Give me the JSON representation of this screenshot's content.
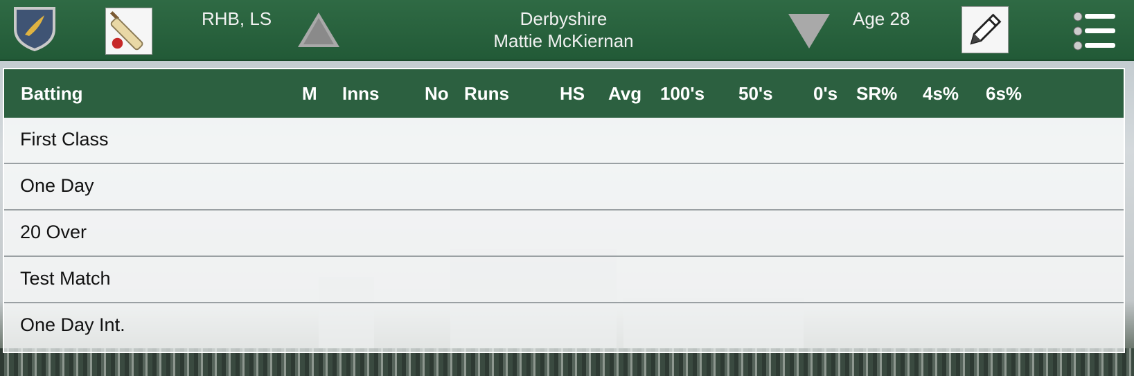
{
  "header": {
    "hand": "RHB, LS",
    "team": "Derbyshire",
    "player": "Mattie McKiernan",
    "age": "Age 28"
  },
  "icons": {
    "club": "shield-icon",
    "category": "cricket-bat-icon",
    "previous": "arrow-up-icon",
    "next": "arrow-down-icon",
    "edit": "pencil-icon",
    "menu": "menu-icon"
  },
  "table": {
    "columns": [
      "Batting",
      "M",
      "Inns",
      "No",
      "Runs",
      "HS",
      "Avg",
      "100's",
      "50's",
      "0's",
      "SR%",
      "4s%",
      "6s%"
    ],
    "rows": [
      {
        "label": "First Class"
      },
      {
        "label": "One Day"
      },
      {
        "label": "20 Over"
      },
      {
        "label": "Test Match"
      },
      {
        "label": "One Day Int."
      }
    ]
  },
  "colors": {
    "header_green": "#2f6a44",
    "table_header_green": "#2c6040"
  }
}
